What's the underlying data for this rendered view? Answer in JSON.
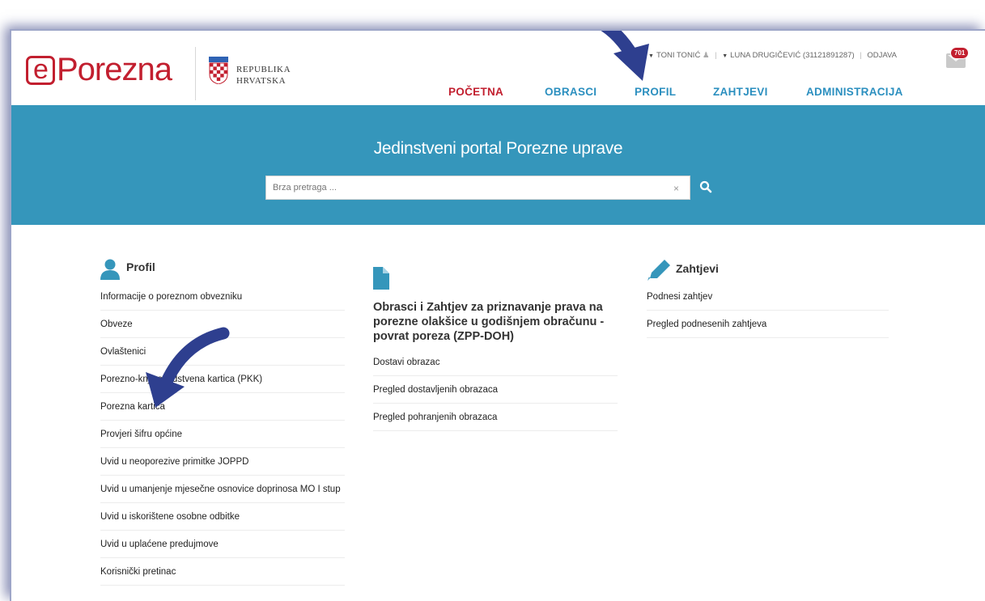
{
  "brand": {
    "logo_e": "e",
    "logo_rest": "Porezna",
    "republic_line1": "REPUBLIKA",
    "republic_line2": "HRVATSKA"
  },
  "user_menu": {
    "user": "TONI TONIĆ",
    "represented": "LUNA DRUGIČEVIĆ (31121891287)",
    "logout": "ODJAVA"
  },
  "notifications": {
    "count": "701"
  },
  "nav": [
    {
      "label": "POČETNA",
      "active": true
    },
    {
      "label": "OBRASCI",
      "active": false
    },
    {
      "label": "PROFIL",
      "active": false
    },
    {
      "label": "ZAHTJEVI",
      "active": false
    },
    {
      "label": "ADMINISTRACIJA",
      "active": false
    }
  ],
  "hero": {
    "title": "Jedinstveni portal Porezne uprave",
    "search_placeholder": "Brza pretraga ...",
    "clear_label": "×"
  },
  "profil": {
    "title": "Profil",
    "links": [
      "Informacije o poreznom obvezniku",
      "Obveze",
      "Ovlaštenici",
      "Porezno-knjigovodstvena kartica (PKK)",
      "Porezna kartica",
      "Provjeri šifru općine",
      "Uvid u neoporezive primitke JOPPD",
      "Uvid u umanjenje mjesečne osnovice doprinosa MO I stup",
      "Uvid u iskorištene osobne odbitke",
      "Uvid u uplaćene predujmove",
      "Korisnički pretinac"
    ]
  },
  "obrasci": {
    "title": "Obrasci i Zahtjev za priznavanje prava na porezne olakšice u godišnjem obračunu - povrat poreza (ZPP-DOH)",
    "links": [
      "Dostavi obrazac",
      "Pregled dostavljenih obrazaca",
      "Pregled pohranjenih obrazaca"
    ]
  },
  "zahtjevi": {
    "title": "Zahtjevi",
    "links": [
      "Podnesi zahtjev",
      "Pregled podnesenih zahtjeva"
    ]
  },
  "colors": {
    "brand_red": "#c21f2f",
    "nav_blue": "#2b8fbf",
    "hero_blue": "#3596bb",
    "annotation_arrow": "#2e3f8f"
  }
}
